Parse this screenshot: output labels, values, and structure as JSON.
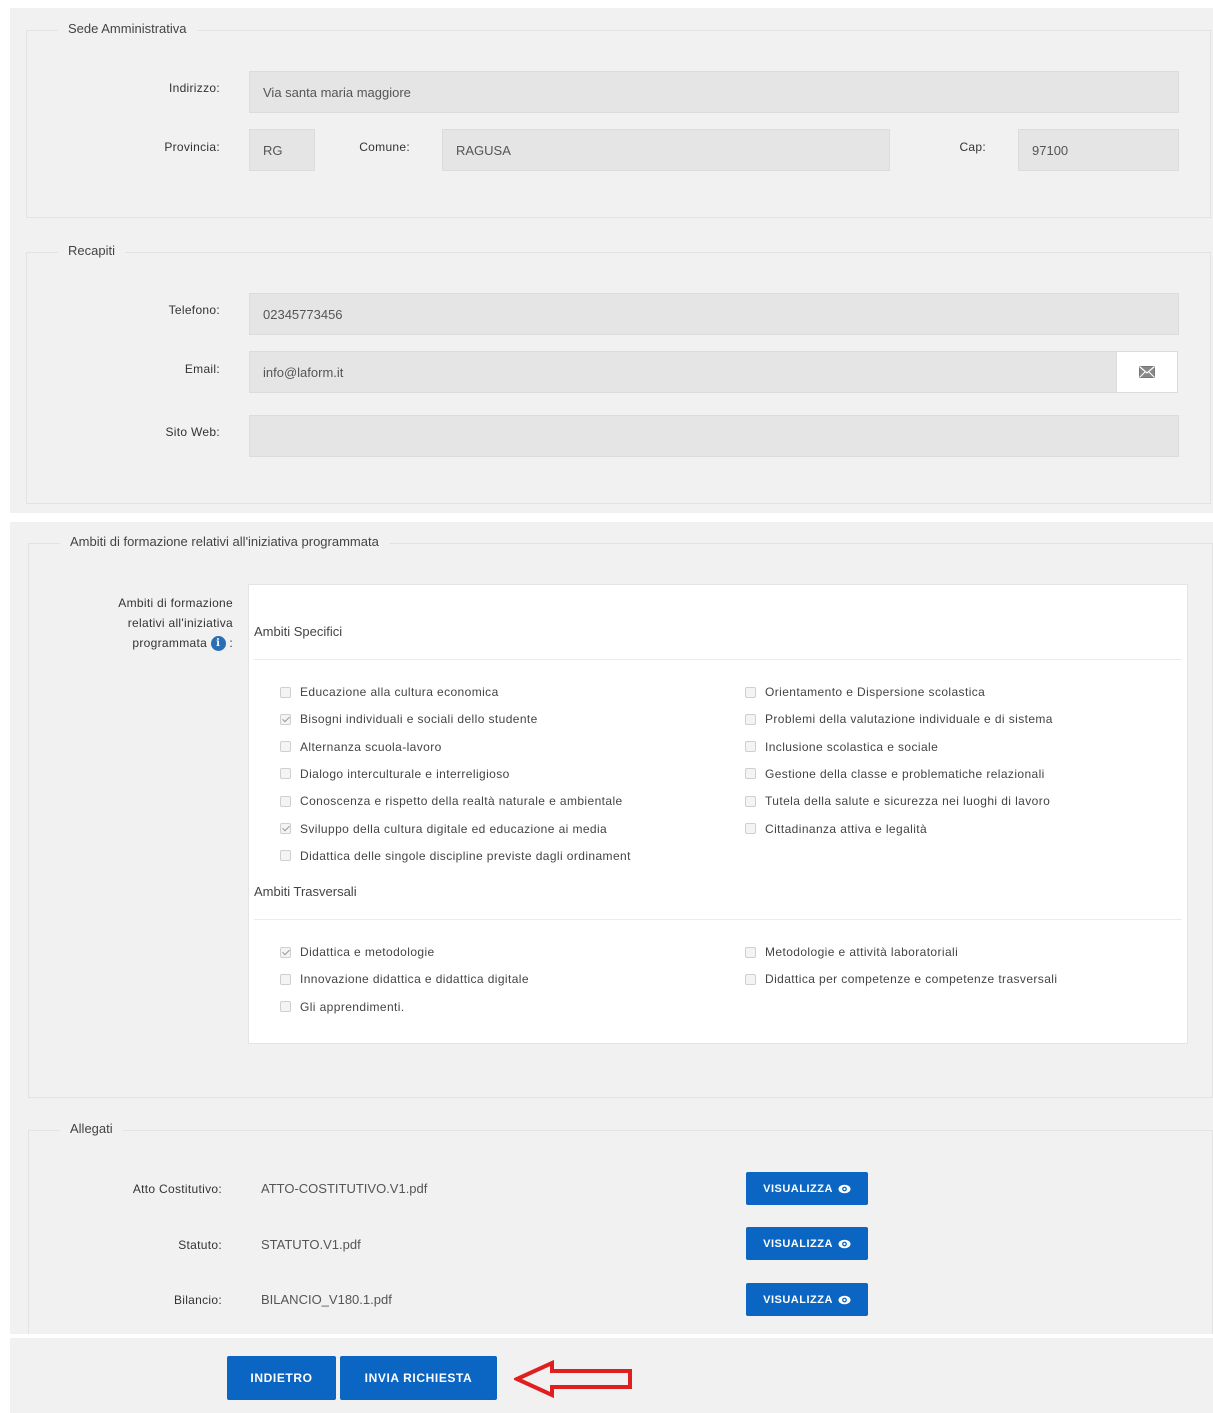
{
  "sede": {
    "legend": "Sede Amministrativa",
    "indirizzo_label": "Indirizzo:",
    "indirizzo_value": "Via santa maria maggiore",
    "provincia_label": "Provincia:",
    "provincia_value": "RG",
    "comune_label": "Comune:",
    "comune_value": "RAGUSA",
    "cap_label": "Cap:",
    "cap_value": "97100"
  },
  "recapiti": {
    "legend": "Recapiti",
    "telefono_label": "Telefono:",
    "telefono_value": "02345773456",
    "email_label": "Email:",
    "email_value": "info@laform.it",
    "sito_label": "Sito Web:",
    "sito_value": ""
  },
  "ambiti": {
    "legend": "Ambiti di formazione relativi all'iniziativa programmata",
    "label_lines": [
      "Ambiti di formazione",
      "relativi all'iniziativa",
      "programmata"
    ],
    "label_suffix": ":",
    "specifici_title": "Ambiti Specifici",
    "specifici_left": [
      {
        "label": "Educazione alla cultura economica",
        "checked": false
      },
      {
        "label": "Bisogni individuali e sociali dello studente",
        "checked": true
      },
      {
        "label": "Alternanza scuola-lavoro",
        "checked": false
      },
      {
        "label": "Dialogo interculturale e interreligioso",
        "checked": false
      },
      {
        "label": "Conoscenza e rispetto della realtà naturale e ambientale",
        "checked": false
      },
      {
        "label": "Sviluppo della cultura digitale ed educazione ai media",
        "checked": true
      },
      {
        "label": "Didattica delle singole discipline previste dagli ordinament",
        "checked": false
      }
    ],
    "specifici_right": [
      {
        "label": "Orientamento e Dispersione scolastica",
        "checked": false
      },
      {
        "label": "Problemi della valutazione individuale e di sistema",
        "checked": false
      },
      {
        "label": "Inclusione scolastica e sociale",
        "checked": false
      },
      {
        "label": "Gestione della classe e problematiche relazionali",
        "checked": false
      },
      {
        "label": "Tutela della salute e sicurezza nei luoghi di lavoro",
        "checked": false
      },
      {
        "label": "Cittadinanza attiva e legalità",
        "checked": false
      }
    ],
    "trasversali_title": "Ambiti Trasversali",
    "trasversali_left": [
      {
        "label": "Didattica e metodologie",
        "checked": true
      },
      {
        "label": "Innovazione didattica e didattica digitale",
        "checked": false
      },
      {
        "label": "Gli apprendimenti.",
        "checked": false
      }
    ],
    "trasversali_right": [
      {
        "label": "Metodologie e attività laboratoriali",
        "checked": false
      },
      {
        "label": "Didattica per competenze e competenze trasversali",
        "checked": false
      }
    ]
  },
  "allegati": {
    "legend": "Allegati",
    "items": [
      {
        "label": "Atto Costitutivo:",
        "file": "ATTO-COSTITUTIVO.V1.pdf",
        "button": "VISUALIZZA"
      },
      {
        "label": "Statuto:",
        "file": "STATUTO.V1.pdf",
        "button": "VISUALIZZA"
      },
      {
        "label": "Bilancio:",
        "file": "BILANCIO_V180.1.pdf",
        "button": "VISUALIZZA"
      }
    ]
  },
  "actions": {
    "back_label": "INDIETRO",
    "submit_label": "INVIA RICHIESTA"
  },
  "colors": {
    "primary": "#0a66c2",
    "arrow": "#e02020"
  }
}
